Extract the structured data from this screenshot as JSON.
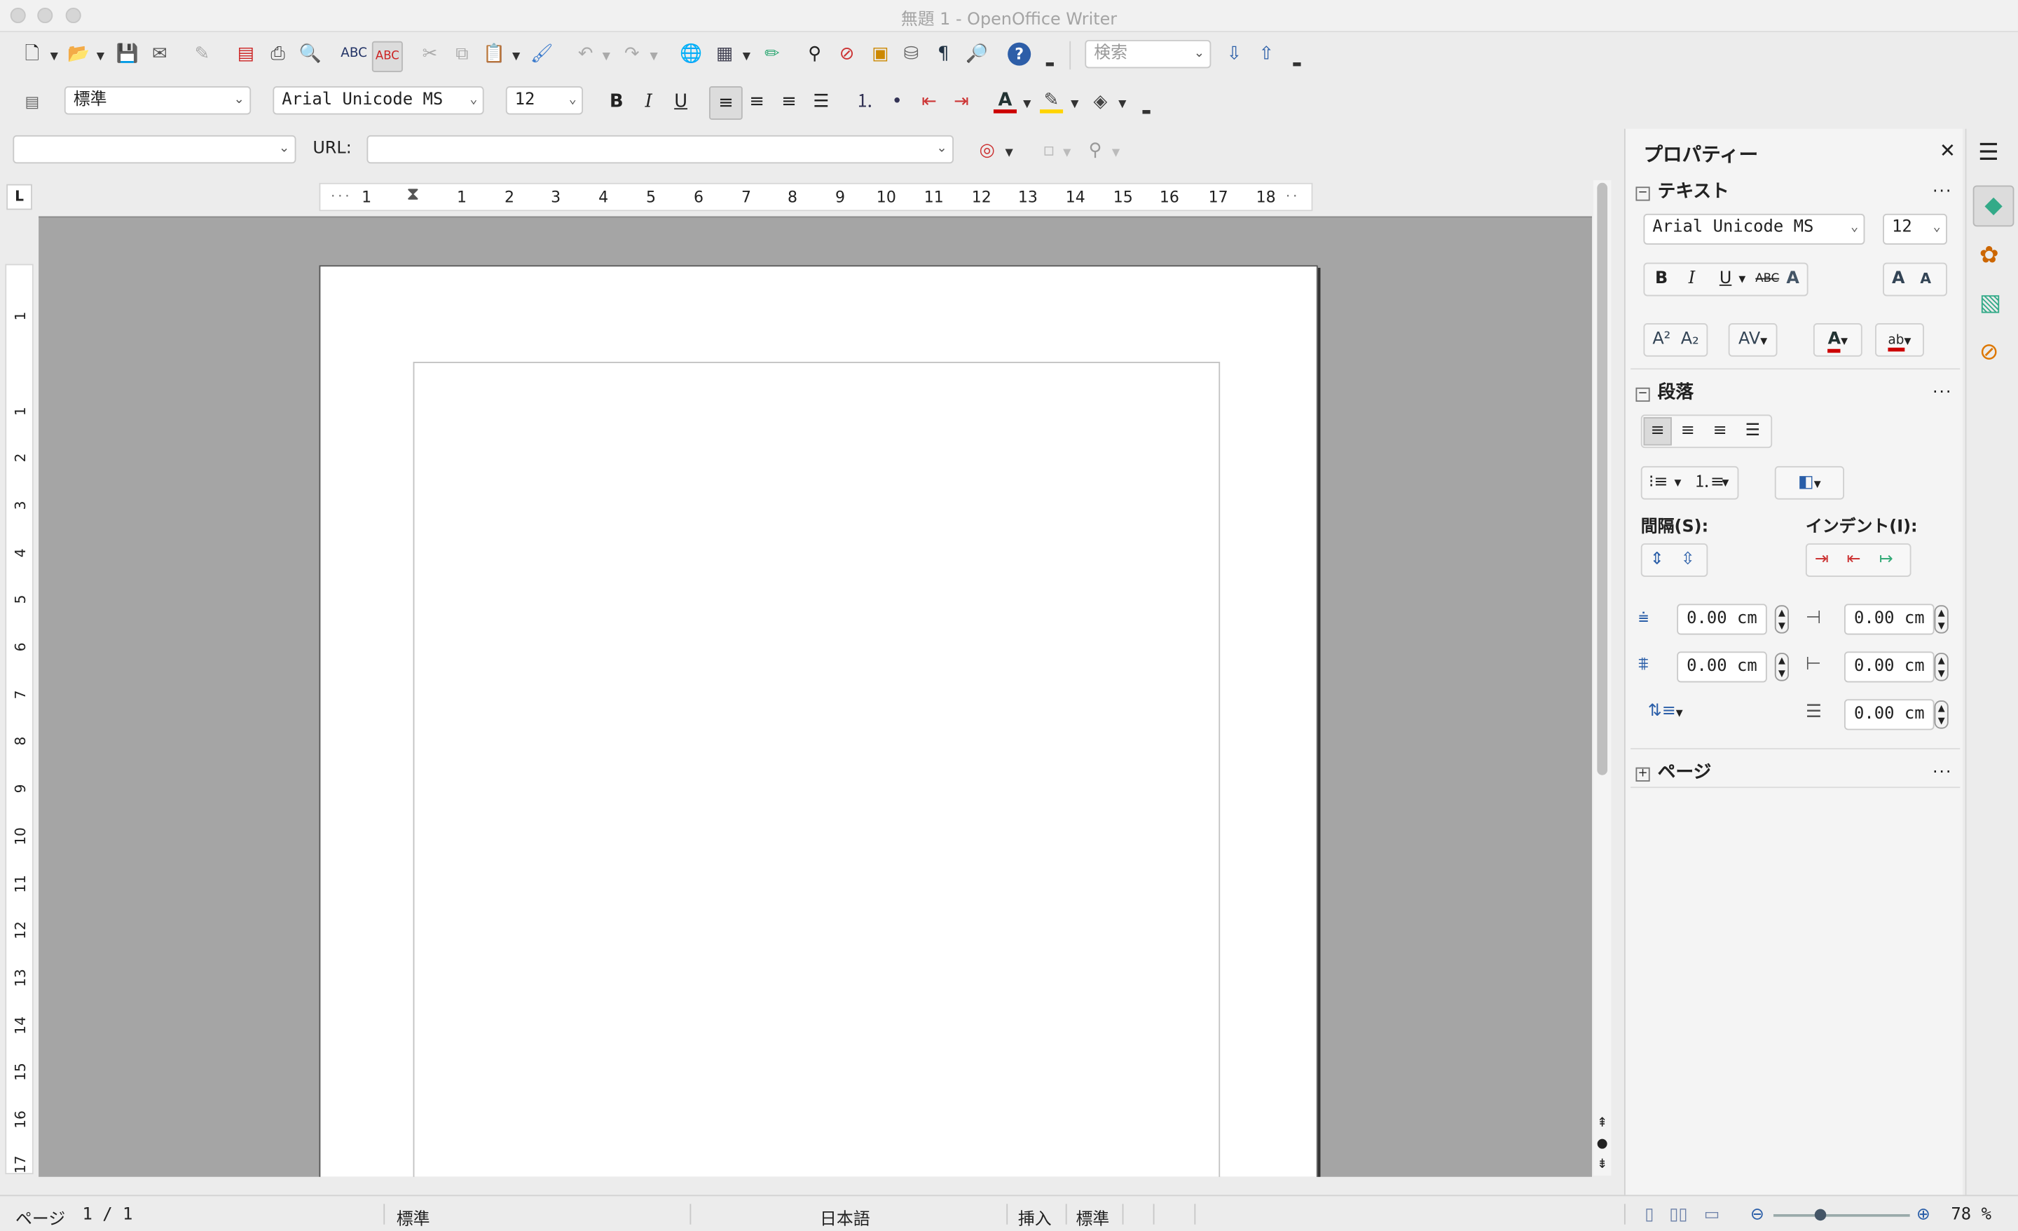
{
  "window": {
    "title": "無題 1 - OpenOffice Writer"
  },
  "toolbar": {
    "search_placeholder": "検索"
  },
  "formatting": {
    "paragraph_style": "標準",
    "font_name": "Arial Unicode MS",
    "font_size": "12",
    "bold": "B",
    "italic": "I",
    "underline": "U"
  },
  "hyperlink_bar": {
    "url_label": "URL:",
    "url_value": ""
  },
  "ruler": {
    "h_numbers": [
      "1",
      "1",
      "2",
      "3",
      "4",
      "5",
      "6",
      "7",
      "8",
      "9",
      "10",
      "11",
      "12",
      "13",
      "14",
      "15",
      "16",
      "17",
      "18"
    ],
    "v_numbers": [
      "1",
      "1",
      "2",
      "3",
      "4",
      "5",
      "6",
      "7",
      "8",
      "9",
      "10",
      "11",
      "12",
      "13",
      "14",
      "15",
      "16",
      "17"
    ]
  },
  "sidebar": {
    "title": "プロパティー",
    "text_section": {
      "heading": "テキスト",
      "font_name": "Arial Unicode MS",
      "font_size": "12"
    },
    "paragraph_section": {
      "heading": "段落",
      "spacing_label": "間隔(S):",
      "indent_label": "インデント(I):",
      "above_spacing": "0.00 cm",
      "below_spacing": "0.00 cm",
      "before_indent": "0.00 cm",
      "after_indent": "0.00 cm",
      "first_line_indent": "0.00 cm"
    },
    "page_section": {
      "heading": "ページ"
    },
    "more": "..."
  },
  "statusbar": {
    "page_label": "ページ",
    "page_value": "1 / 1",
    "page_style": "標準",
    "language": "日本語",
    "insert_mode": "挿入",
    "selection_mode": "標準",
    "zoom": "78 %"
  },
  "colors": {
    "font_color": "#cc0000",
    "highlight_color": "#ffd400",
    "accent": "#3a5fa8"
  }
}
